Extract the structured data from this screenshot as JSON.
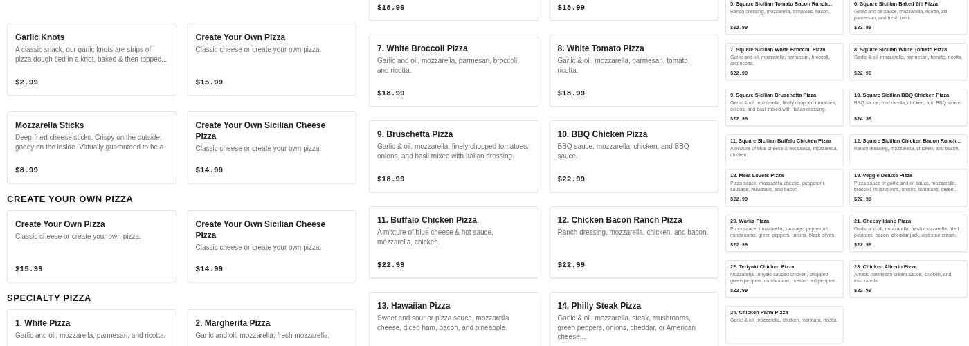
{
  "panels": [
    {
      "kind": "large",
      "blocks": [
        {
          "kind": "cards",
          "cards": [
            {
              "title": "Garlic Knots",
              "description": "A classic snack, our garlic knots are strips of pizza dough tied in a knot, baked & then topped...",
              "price": "$2.99"
            },
            {
              "title": "Create Your Own Pizza",
              "description": "Classic cheese or create your own pizza.",
              "price": "$15.99"
            }
          ]
        },
        {
          "kind": "cards",
          "cards": [
            {
              "title": "Mozzarella Sticks",
              "description": "Deep-fried cheese sticks. Crispy on the outside, gooey on the inside. Virtually guaranteed to be a",
              "price": "$8.99"
            },
            {
              "title": "Create Your Own Sicilian Cheese Pizza",
              "description": "Classic cheese or create your own pizza.",
              "price": "$14.99"
            }
          ]
        },
        {
          "kind": "heading",
          "text": "CREATE YOUR OWN PIZZA"
        },
        {
          "kind": "cards",
          "cards": [
            {
              "title": "Create Your Own Pizza",
              "description": "Classic cheese or create your own pizza.",
              "price": "$15.99"
            },
            {
              "title": "Create Your Own Sicilian Cheese Pizza",
              "description": "Classic cheese or create your own pizza.",
              "price": "$14.99"
            }
          ]
        },
        {
          "kind": "heading",
          "text": "SPECIALTY PIZZA"
        },
        {
          "kind": "cards",
          "cards": [
            {
              "title": "1. White Pizza",
              "description": "Garlic and oil, mozzarella, parmesan, and ricotta."
            },
            {
              "title": "2. Margherita Pizza",
              "description": "Garlic and oil, mozzarella, fresh mozzarella,"
            }
          ]
        }
      ]
    },
    {
      "kind": "medium",
      "blocks": [
        {
          "kind": "cards",
          "cards": [
            {
              "price": "$18.99"
            },
            {
              "price": "$18.99"
            }
          ]
        },
        {
          "kind": "cards",
          "cards": [
            {
              "title": "7. White Broccoli Pizza",
              "description": "Garlic and oil, mozzarella, parmesan, broccoli, and ricotta.",
              "price": "$18.99"
            },
            {
              "title": "8. White Tomato Pizza",
              "description": "Garlic & oil, mozzarella, parmesan, tomato, ricotta.",
              "price": "$18.99"
            }
          ]
        },
        {
          "kind": "cards",
          "cards": [
            {
              "title": "9. Bruschetta Pizza",
              "description": "Garlic & oil, mozzarella, finely chopped tomatoes, onions, and basil mixed with Italian dressing.",
              "price": "$18.99"
            },
            {
              "title": "10. BBQ Chicken Pizza",
              "description": "BBQ sauce, mozzarella, chicken, and BBQ sauce.",
              "price": "$22.99"
            }
          ]
        },
        {
          "kind": "cards",
          "cards": [
            {
              "title": "11. Buffalo Chicken Pizza",
              "description": "A mixture of blue cheese & hot sauce, mozzarella, chicken.",
              "price": "$22.99"
            },
            {
              "title": "12. Chicken Bacon Ranch Pizza",
              "description": "Ranch dressing, mozzarella, chicken, and bacon.",
              "price": "$22.99"
            }
          ]
        },
        {
          "kind": "cards",
          "cards": [
            {
              "title": "13. Hawaiian Pizza",
              "description": "Sweet and sour or pizza sauce, mozzarella cheese, diced ham, bacon, and pineapple."
            },
            {
              "title": "14. Philly Steak Pizza",
              "description": "Garlic & oil, mozzarella, steak, mushrooms, green peppers, onions, cheddar, or American cheese..."
            }
          ]
        }
      ]
    },
    {
      "kind": "small",
      "blocks": [
        {
          "kind": "cards",
          "cards": [
            {
              "title": "5. Square Sicilian Tomato Bacon Ranch...",
              "description": "Ranch dressing, mozzarella, tomatoes, bacon,",
              "price": "$22.99"
            },
            {
              "title": "6. Square Sicilian Baked Ziti Pizza",
              "description": "Garlic and oil sauce, mozzarella, ricotta, ziti parmesan, and fresh basil.",
              "price": "$22.99"
            }
          ]
        },
        {
          "kind": "cards",
          "cards": [
            {
              "title": "7. Square Sicilian White Broccoli Pizza",
              "description": "Garlic and oil, mozzarella, parmesan, broccoli, and ricotta.",
              "price": "$22.99"
            },
            {
              "title": "8. Square Sicilian White Tomato Pizza",
              "description": "Garlic & oil, mozzarella, parmesan, tomato, ricotta.",
              "price": "$22.99"
            }
          ]
        },
        {
          "kind": "cards",
          "cards": [
            {
              "title": "9. Square Sicilian Bruschetta Pizza",
              "description": "Garlic & oil, mozzarella, finely chopped tomatoes, onions, and basil mixed with Italian dressing.",
              "price": "$22.99"
            },
            {
              "title": "10. Square Sicilian BBQ Chicken Pizza",
              "description": "BBQ sauce, mozzarella, chicken, and BBQ sauce.",
              "price": "$24.99"
            }
          ]
        },
        {
          "kind": "cards",
          "cards": [
            {
              "title": "11. Square Sicilian Buffalo Chicken Pizza",
              "description": "A mixture of blue cheese & hot sauce, mozzarella, chicken."
            },
            {
              "title": "12. Square Sicilian Chicken Bacon Ranch...",
              "description": "Ranch dressing, mozzarella, chicken, and bacon."
            }
          ]
        },
        {
          "kind": "cards",
          "cards": [
            {
              "title": "18. Meat Lovers Pizza",
              "description": "Pizza sauce, mozzarella cheese, pepperoni, sausage, meatballs, and bacon.",
              "price": "$22.99"
            },
            {
              "title": "19. Veggie Deluxe Pizza",
              "description": "Pizza sauce or garlic and oil sauce, mozzarella, broccoli, mushrooms, onions, tomatoes, green...",
              "price": "$22.99"
            }
          ]
        },
        {
          "kind": "cards",
          "cards": [
            {
              "title": "20. Works Pizza",
              "description": "Pizza sauce, mozzarella, sausage, pepperoni, mushrooms, green peppers, onions, black olives.",
              "price": "$22.99"
            },
            {
              "title": "21. Cheesy Idaho Pizza",
              "description": "Garlic and oil, mozzarella, fresh mozzarella, fried potatoes, bacon, cheddar jack, and sour cream.",
              "price": "$22.99"
            }
          ]
        },
        {
          "kind": "cards",
          "cards": [
            {
              "title": "22. Teriyaki Chicken Pizza",
              "description": "Mozzarella, teriyaki-sauced chicken, chopped green peppers, mushrooms, roasted red peppers.",
              "price": "$22.99"
            },
            {
              "title": "23. Chicken Alfredo Pizza",
              "description": "Alfredo parmesan cream sauce, chicken, and mozzarella.",
              "price": "$22.99"
            }
          ]
        },
        {
          "kind": "cards",
          "cards": [
            {
              "title": "24. Chicken Parm Pizza",
              "description": "Garlic & oil, mozzarella, chicken, marinara, ricotta."
            }
          ]
        }
      ]
    }
  ]
}
